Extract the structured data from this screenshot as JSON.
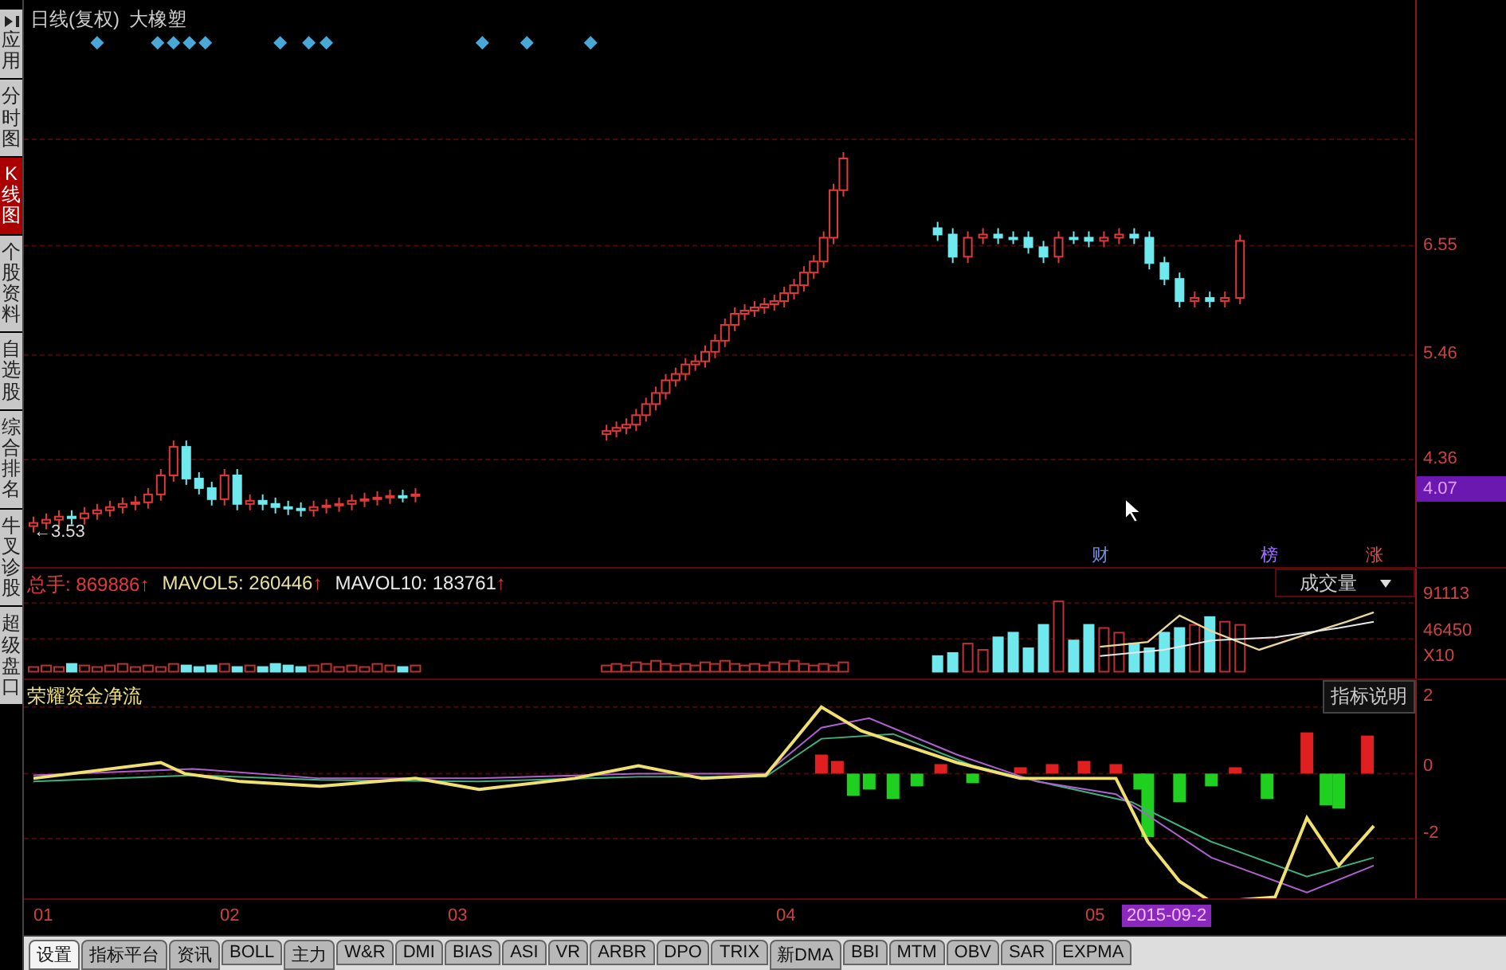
{
  "sidebar_tabs": [
    {
      "label": "应用",
      "selected": false
    },
    {
      "label": "分时图",
      "selected": false
    },
    {
      "label": "K线图",
      "selected": true
    },
    {
      "label": "个股资料",
      "selected": false
    },
    {
      "label": "自选股",
      "selected": false
    },
    {
      "label": "综合排名",
      "selected": false
    },
    {
      "label": "牛叉诊股",
      "selected": false
    },
    {
      "label": "超级盘口",
      "selected": false
    }
  ],
  "price_chart": {
    "period": "日线(复权)",
    "stock_name": "大橡塑",
    "axis_labels": [
      "6.55",
      "5.46",
      "4.36"
    ],
    "current_price": "4.07",
    "low_label": "←3.53",
    "markers": [
      {
        "label": "财",
        "color": "#6f8fe0"
      },
      {
        "label": "榜",
        "color": "#a070ff"
      },
      {
        "label": "涨",
        "color": "#e05050"
      }
    ]
  },
  "volume_panel": {
    "stats": [
      {
        "label": "总手:",
        "value": "869886",
        "arrow": "↑",
        "color": "#e03a3a"
      },
      {
        "label": "MAVOL5:",
        "value": "260446",
        "arrow": "↑",
        "color": "#e8e0a0"
      },
      {
        "label": "MAVOL10:",
        "value": "183761",
        "arrow": "↑",
        "color": "#e8e8e8"
      }
    ],
    "indicator_select": "成交量",
    "axis_labels": [
      "91113",
      "46450",
      "X10"
    ]
  },
  "indicator_panel": {
    "title": "荣耀资金净流",
    "help_button": "指标说明",
    "axis_labels": [
      "2",
      "0",
      "-2"
    ]
  },
  "x_axis": {
    "labels": [
      "01",
      "02",
      "03",
      "04",
      "05"
    ],
    "cursor_date": "2015-09-2"
  },
  "bottom_tabs": [
    {
      "label": "设置",
      "selected": true
    },
    {
      "label": "指标平台",
      "selected": false
    },
    {
      "label": "资讯",
      "selected": false
    },
    {
      "label": "BOLL",
      "selected": false
    },
    {
      "label": "主力",
      "selected": false
    },
    {
      "label": "W&R",
      "selected": false
    },
    {
      "label": "DMI",
      "selected": false
    },
    {
      "label": "BIAS",
      "selected": false
    },
    {
      "label": "ASI",
      "selected": false
    },
    {
      "label": "VR",
      "selected": false
    },
    {
      "label": "ARBR",
      "selected": false
    },
    {
      "label": "DPO",
      "selected": false
    },
    {
      "label": "TRIX",
      "selected": false
    },
    {
      "label": "新DMA",
      "selected": false
    },
    {
      "label": "BBI",
      "selected": false
    },
    {
      "label": "MTM",
      "selected": false
    },
    {
      "label": "OBV",
      "selected": false
    },
    {
      "label": "SAR",
      "selected": false
    },
    {
      "label": "EXPMA",
      "selected": false
    }
  ]
}
